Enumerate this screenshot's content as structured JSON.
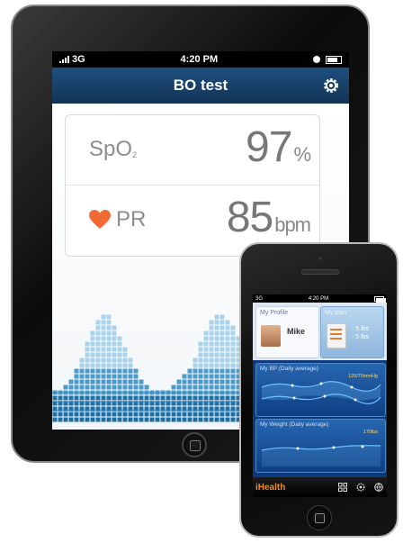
{
  "tablet": {
    "status": {
      "carrier": "3G",
      "time": "4:20 PM"
    },
    "nav": {
      "title": "BO test",
      "settings_icon": "gear-icon"
    },
    "spo2": {
      "label": "SpO",
      "label_sub": "2",
      "value": "97",
      "unit": "%"
    },
    "pr": {
      "icon": "heart-icon",
      "label": "PR",
      "value": "85",
      "unit": "bpm"
    },
    "colors": {
      "nav": "#1f4f7f",
      "heart": "#f06a33",
      "wave": "#1e7fb5"
    }
  },
  "phone": {
    "status": {
      "carrier": "3G",
      "time": "4:20 PM"
    },
    "tiles": {
      "profile_title": "My Profile",
      "profile_name": "Mike",
      "plan_title": "My plan",
      "plan_line1": "- 5 lbs",
      "plan_line2": "- 5 lbs"
    },
    "bp_card": {
      "title": "My BP (Daily average)",
      "value": "120/75mmHg"
    },
    "weight_card": {
      "title": "My Weight (Daily average)",
      "value": "170lbs"
    },
    "tab_bar": {
      "brand": "iHealth",
      "icons": [
        "grid-icon",
        "gear-icon",
        "globe-icon"
      ]
    }
  }
}
